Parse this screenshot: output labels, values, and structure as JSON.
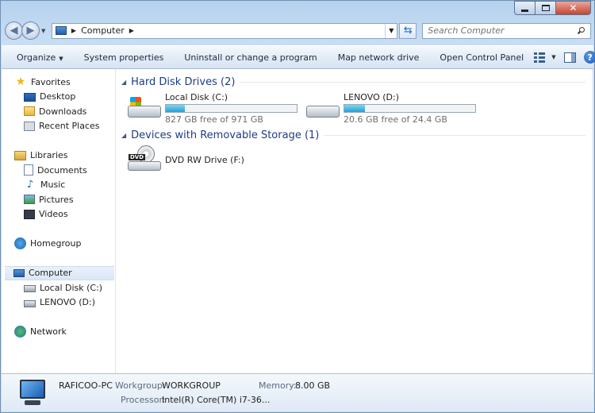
{
  "nav": {
    "address_crumb": "Computer",
    "search_placeholder": "Search Computer"
  },
  "toolbar": {
    "organize": "Organize",
    "system_properties": "System properties",
    "uninstall": "Uninstall or change a program",
    "map_drive": "Map network drive",
    "control_panel": "Open Control Panel",
    "help": "?"
  },
  "sidebar": {
    "favorites": "Favorites",
    "desktop": "Desktop",
    "downloads": "Downloads",
    "recent": "Recent Places",
    "libraries": "Libraries",
    "documents": "Documents",
    "music": "Music",
    "pictures": "Pictures",
    "videos": "Videos",
    "homegroup": "Homegroup",
    "computer": "Computer",
    "local_disk": "Local Disk (C:)",
    "lenovo": "LENOVO (D:)",
    "network": "Network"
  },
  "main": {
    "hdd_group": "Hard Disk Drives (2)",
    "removable_group": "Devices with Removable Storage (1)",
    "drives": [
      {
        "name": "Local Disk (C:)",
        "free": "827 GB free of 971 GB",
        "used_fraction": 0.148
      },
      {
        "name": "LENOVO (D:)",
        "free": "20.6 GB free of 24.4 GB",
        "used_fraction": 0.156
      }
    ],
    "dvd": {
      "name": "DVD RW Drive (F:)",
      "label": "DVD"
    }
  },
  "details": {
    "pc_name": "RAFICOO-PC",
    "workgroup_label": "Workgroup:",
    "workgroup_value": "WORKGROUP",
    "memory_label": "Memory:",
    "memory_value": "8.00 GB",
    "processor_label": "Processor:",
    "processor_value": "Intel(R) Core(TM) i7-36..."
  }
}
